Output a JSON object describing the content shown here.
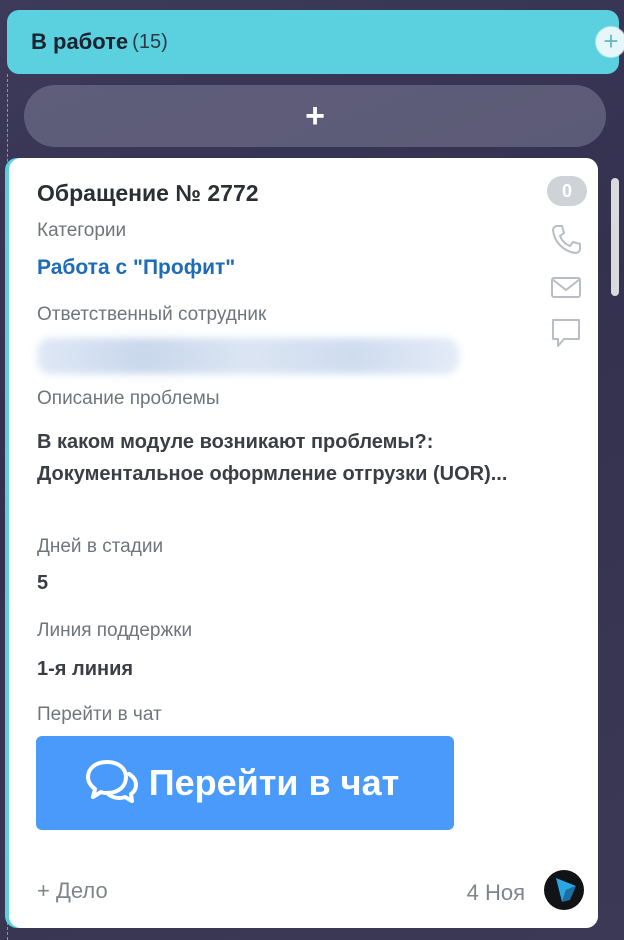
{
  "stage": {
    "title": "В работе",
    "count": "(15)",
    "plus": "+"
  },
  "quick_add": {
    "label": "+"
  },
  "card": {
    "title": "Обращение № 2772",
    "comments_count": "0",
    "fields": {
      "category_label": "Категории",
      "category_value": "Работа с \"Профит\"",
      "responsible_label": "Ответственный сотрудник",
      "description_label": "Описание проблемы",
      "description_value": "В каком модуле возникают проблемы?: Документальное оформление отгрузки (UOR)...",
      "days_label": "Дней в стадии",
      "days_value": "5",
      "line_label": "Линия поддержки",
      "line_value": "1-я линия",
      "chat_label": "Перейти в чат"
    },
    "chat_button": {
      "label": "Перейти в чат",
      "icon": "chat-bubbles-icon"
    },
    "icons": [
      "phone-icon",
      "mail-icon",
      "comment-icon"
    ],
    "footer": {
      "add_deal": "+ Дело",
      "date": "4 Ноя",
      "avatar_icon": "avatar-icon"
    }
  },
  "colors": {
    "stage_accent": "#5bd0df",
    "link": "#1e6bb8",
    "chat_button": "#4a9afc",
    "background": "#3d3a5a"
  }
}
